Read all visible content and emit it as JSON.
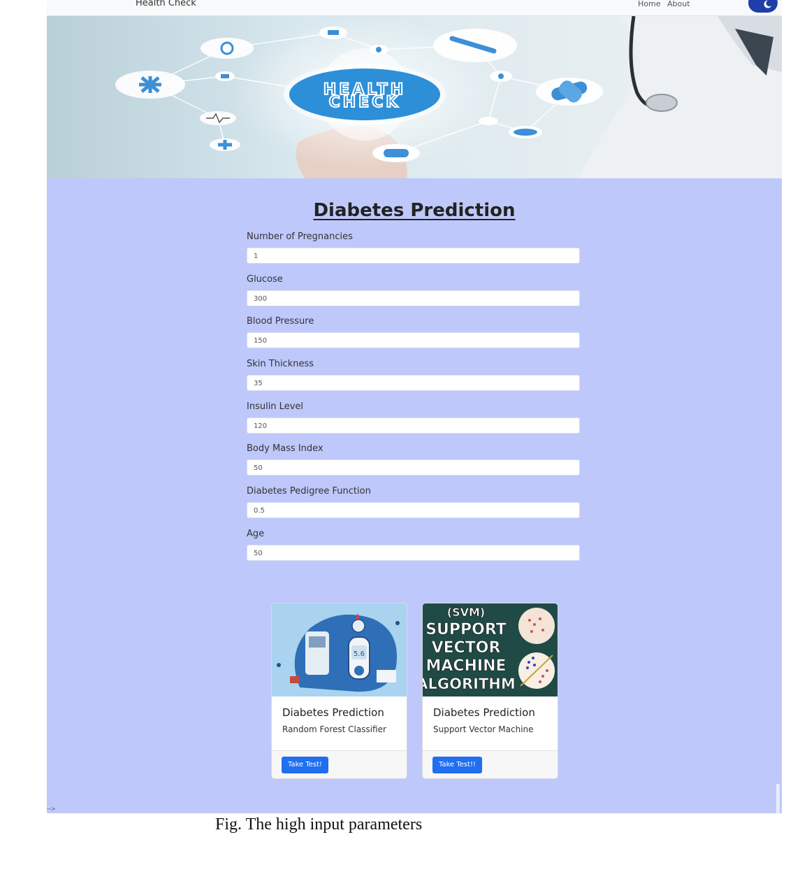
{
  "navbar": {
    "brand": "Health Check",
    "links": [
      {
        "label": "Home"
      },
      {
        "label": "About"
      }
    ]
  },
  "hero": {
    "text_line1": "HEALTH",
    "text_line2": "CHECK"
  },
  "form": {
    "title": "Diabetes Prediction",
    "fields": [
      {
        "label": "Number of Pregnancies",
        "value": "1"
      },
      {
        "label": "Glucose",
        "value": "300"
      },
      {
        "label": "Blood Pressure",
        "value": "150"
      },
      {
        "label": "Skin Thickness",
        "value": "35"
      },
      {
        "label": "Insulin Level",
        "value": "120"
      },
      {
        "label": "Body Mass Index",
        "value": "50"
      },
      {
        "label": "Diabetes Pedigree Function",
        "value": "0.5"
      },
      {
        "label": "Age",
        "value": "50"
      }
    ]
  },
  "cards": [
    {
      "title": "Diabetes Prediction",
      "subtitle": "Random Forest Classifier",
      "button": "Take Test!",
      "image_reading": "5.6"
    },
    {
      "title": "Diabetes Prediction",
      "subtitle": "Support Vector Machine",
      "button": "Take Test!!",
      "image_text": [
        "(SVM)",
        "SUPPORT",
        "VECTOR",
        "MACHINE",
        "ALGORITHM"
      ]
    }
  ],
  "stray_text": "-->",
  "caption": "Fig. The high input parameters",
  "colors": {
    "page_bg": "#bec8fa",
    "button": "#1f6ff0",
    "toggle": "#1f3fa8"
  }
}
